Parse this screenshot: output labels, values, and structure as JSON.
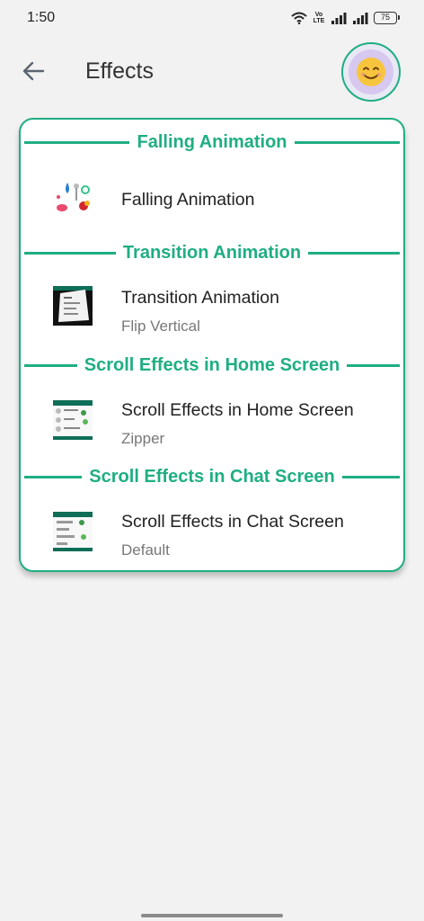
{
  "status_bar": {
    "time": "1:50",
    "volte_label": "Vo LTE",
    "battery": "75",
    "icons": [
      "wifi-icon",
      "volte-icon",
      "signal-icon",
      "signal-icon",
      "battery-icon"
    ]
  },
  "app_bar": {
    "title": "Effects",
    "back_icon": "arrow-left-icon",
    "avatar_icon": "smiling-face-icon"
  },
  "sections": [
    {
      "header": "Falling Animation",
      "item_title": "Falling Animation",
      "item_subtitle": ""
    },
    {
      "header": "Transition Animation",
      "item_title": "Transition Animation",
      "item_subtitle": "Flip Vertical"
    },
    {
      "header": "Scroll Effects in Home Screen",
      "item_title": "Scroll Effects in Home Screen",
      "item_subtitle": "Zipper"
    },
    {
      "header": "Scroll Effects in Chat Screen",
      "item_title": "Scroll Effects in Chat Screen",
      "item_subtitle": "Default"
    }
  ],
  "colors": {
    "accent": "#1fae83",
    "background": "#f2f2f2",
    "card": "#ffffff",
    "avatar_bg": "#d7c8ef"
  }
}
